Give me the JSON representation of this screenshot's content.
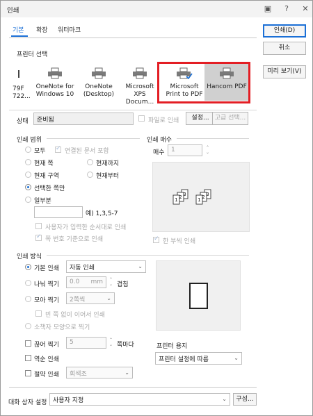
{
  "window": {
    "title": "인쇄",
    "help_glyph": "?",
    "close_glyph": "✕",
    "screen_glyph": "▣"
  },
  "tabs": [
    {
      "label": "기본"
    },
    {
      "label": "확장"
    },
    {
      "label": "워터마크"
    }
  ],
  "buttons": {
    "print": "인쇄(D)",
    "cancel": "취소",
    "preview": "미리 보기(V)"
  },
  "printer_select": {
    "section": "프린터 선택",
    "printers": [
      {
        "line1": "79F",
        "line2": "722..."
      },
      {
        "line1": "OneNote for",
        "line2": "Windows 10"
      },
      {
        "line1": "OneNote",
        "line2": "(Desktop)"
      },
      {
        "line1": "Microsoft",
        "line2": "XPS Docum..."
      },
      {
        "line1": "Microsoft",
        "line2": "Print to PDF"
      },
      {
        "line1": "Hancom PDF",
        "line2": ""
      }
    ],
    "status_label": "상태",
    "status_value": "준비됨",
    "file_print_label": "파일로 인쇄",
    "settings_button": "설정...",
    "advanced_button": "고급 선택..."
  },
  "print_range": {
    "section": "인쇄 범위",
    "all": "모두",
    "linked_docs": "연결된 문서 포함",
    "current_page": "현재 쪽",
    "until_current": "현재까지",
    "current_section": "현재 구역",
    "from_current": "현재부터",
    "selection": "선택한 쪽만",
    "partial": "일부분",
    "example": "예) 1,3,5-7",
    "user_order": "사용자가 입력한 순서대로 인쇄",
    "page_number_basis": "쪽 번호 기준으로 인쇄"
  },
  "copies": {
    "section": "인쇄 매수",
    "label": "매수",
    "value": "1",
    "collate": "한 부씩 인쇄"
  },
  "print_method": {
    "section": "인쇄 방식",
    "basic": "기본 인쇄",
    "basic_mode": "자동 인쇄",
    "tile": "나눠 찍기",
    "tile_value": "0.0",
    "tile_unit": "mm",
    "overlap": "겹침",
    "collect": "모아 찍기",
    "collect_value": "2쪽씩",
    "no_gap": "빈 쪽 없이 이어서 인쇄",
    "booklet": "소책자 모양으로 찍기",
    "pull": "끊어 찍기",
    "pull_value": "5",
    "pull_unit": "쪽마다",
    "reverse": "역순 인쇄",
    "save": "절약 인쇄",
    "save_value": "회색조",
    "paper_label": "프린터 용지",
    "paper_value": "프린터 설정에 따름"
  },
  "footer": {
    "label": "대화 상자 설정",
    "value": "사용자 지정",
    "config_button": "구성..."
  },
  "colors": {
    "accent": "#1a6fd6",
    "highlight": "#e31e24"
  }
}
